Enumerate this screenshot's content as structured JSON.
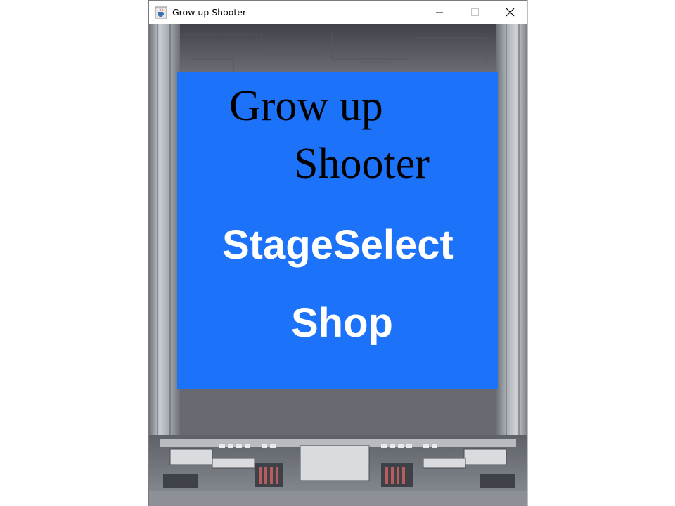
{
  "window": {
    "title": "Grow up Shooter",
    "icon": "java-cup-icon"
  },
  "controls": {
    "minimize_icon": "minimize-icon",
    "maximize_icon": "maximize-icon",
    "close_icon": "close-icon"
  },
  "game": {
    "title_line1": "Grow up",
    "title_line2": "Shooter",
    "menu": {
      "stage_select": "StageSelect",
      "shop": "Shop"
    }
  },
  "colors": {
    "screen": "#1c72f8",
    "menu_text": "#ffffff",
    "title_text": "#000000",
    "frame": "#9aa0a6"
  }
}
